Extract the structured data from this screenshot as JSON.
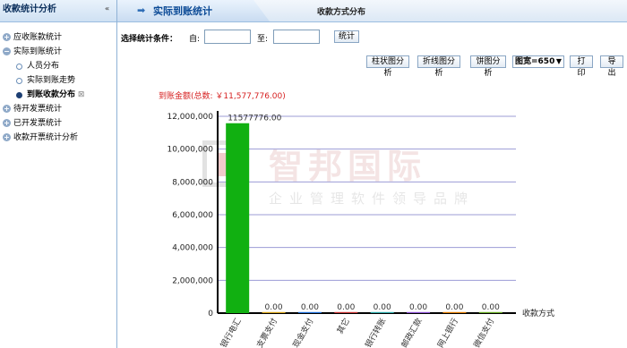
{
  "sidebar": {
    "title": "收款统计分析",
    "collapse_icon": "chevron-left-icon",
    "items": [
      {
        "label": "应收账款统计",
        "level": 0,
        "icon": "plus"
      },
      {
        "label": "实际到账统计",
        "level": 0,
        "icon": "minus"
      },
      {
        "label": "人员分布",
        "level": 1,
        "active": false
      },
      {
        "label": "实际到账走势",
        "level": 1,
        "active": false
      },
      {
        "label": "到账收款分布",
        "level": 1,
        "active": true
      },
      {
        "label": "待开发票统计",
        "level": 0,
        "icon": "plus"
      },
      {
        "label": "已开发票统计",
        "level": 0,
        "icon": "plus"
      },
      {
        "label": "收款开票统计分析",
        "level": 0,
        "icon": "plus"
      }
    ]
  },
  "header": {
    "active_tab": "实际到账统计",
    "subtitle": "收款方式分布"
  },
  "filter": {
    "label": "选择统计条件：",
    "from_label": "自:",
    "to_label": "至:",
    "from_value": "",
    "to_value": "",
    "stat_button": "统计"
  },
  "toolbar": {
    "bar_button": "柱状图分析",
    "line_button": "折线图分析",
    "pie_button": "饼图分析",
    "width_select": "图宽=650",
    "print_button": "打印",
    "export_button": "导出"
  },
  "chart_data": {
    "type": "bar",
    "title": "到账金额(总数: ￥11,577,776.00)",
    "xlabel": "收款方式",
    "ylabel": "",
    "ylim": [
      0,
      12000000
    ],
    "yticks": [
      "0",
      "2,000,000",
      "4,000,000",
      "6,000,000",
      "8,000,000",
      "10,000,000",
      "12,000,000"
    ],
    "categories": [
      "银行电汇",
      "支票支付",
      "现金支付",
      "其它",
      "银行转账",
      "邮政汇款",
      "网上银行",
      "微信支付"
    ],
    "values": [
      11577776,
      0,
      0,
      0,
      0,
      0,
      0,
      0
    ],
    "value_labels": [
      "11577776.00",
      "0.00",
      "0.00",
      "0.00",
      "0.00",
      "0.00",
      "0.00",
      "0.00"
    ],
    "bar_colors": [
      "#11b011",
      "#d4a017",
      "#1e6fd9",
      "#c83232",
      "#2aa7a7",
      "#8a4fd1",
      "#e07b00",
      "#66aa22"
    ],
    "grid": true
  },
  "watermark": {
    "text": "智邦国际",
    "subtext": "企业管理软件领导品牌"
  },
  "colors": {
    "accent": "#0b4a96",
    "grid": "#9c9cd6",
    "title_red": "#d62020"
  }
}
